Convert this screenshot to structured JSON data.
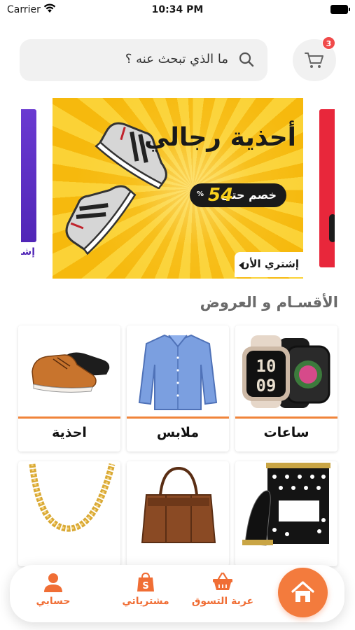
{
  "status_bar": {
    "carrier": "Carrier",
    "time": "10:34 PM"
  },
  "search": {
    "placeholder": "ما الذي تبحث عنه ؟"
  },
  "cart": {
    "badge_count": "3"
  },
  "banner": {
    "title": "أحذية رجالي",
    "discount_label": "خصم حتى",
    "discount_value": "54",
    "discount_unit": "%",
    "cta": "إشتري الأن",
    "peek_left_text": "إشت"
  },
  "section_title": "الأقسـام و العروض",
  "categories": [
    {
      "label": "ساعات",
      "icon": "smartwatch-image"
    },
    {
      "label": "ملابس",
      "icon": "shirt-image"
    },
    {
      "label": "احذية",
      "icon": "shoe-image"
    },
    {
      "label": "",
      "icon": "perfume-image"
    },
    {
      "label": "",
      "icon": "handbag-image"
    },
    {
      "label": "",
      "icon": "gold-chain-image"
    }
  ],
  "bottom_nav": {
    "cart": "عربة التسوق",
    "purchases": "مشترياتي",
    "account": "حسابي"
  },
  "colors": {
    "accent": "#f06e35",
    "badge": "#f04a4a",
    "banner_yellow": "#f6b90d"
  }
}
